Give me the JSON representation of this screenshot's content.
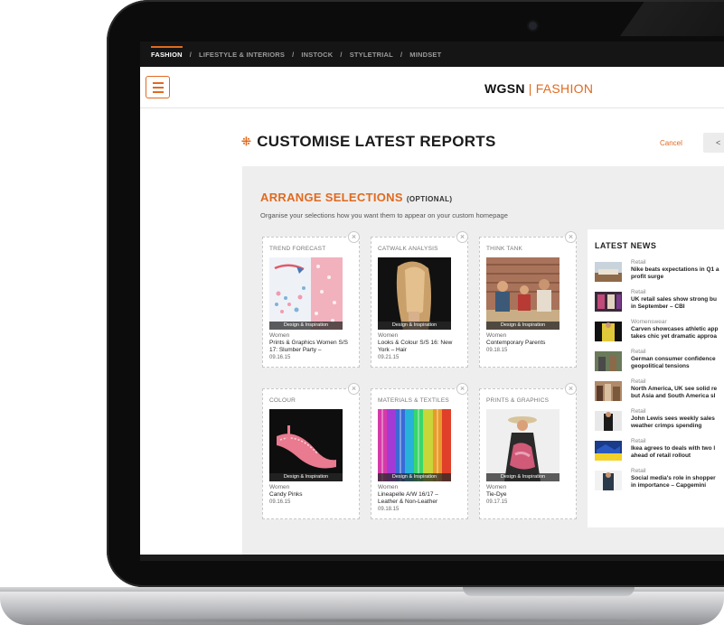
{
  "nav": {
    "items": [
      "FASHION",
      "LIFESTYLE & INTERIORS",
      "INSTOCK",
      "STYLETRIAL",
      "MINDSET"
    ],
    "separator": "/"
  },
  "brand": {
    "name": "WGSN",
    "divider": "|",
    "section": "FASHION"
  },
  "page": {
    "title": "CUSTOMISE LATEST REPORTS",
    "cancel_label": "Cancel",
    "back_label": "<"
  },
  "arrange": {
    "title": "ARRANGE SELECTIONS",
    "optional": "(OPTIONAL)",
    "description": "Organise your selections how you want them to appear on your custom homepage",
    "close_symbol": "×"
  },
  "cards": [
    {
      "category": "TREND FORECAST",
      "tag": "Design & Inspiration",
      "gender": "Women",
      "name": "Prints & Graphics Women S/S 17: Slumber Party –",
      "date": "09.16.15"
    },
    {
      "category": "CATWALK ANALYSIS",
      "tag": "Design & Inspiration",
      "gender": "Women",
      "name": "Looks & Colour S/S 16: New York – Hair",
      "date": "09.21.15"
    },
    {
      "category": "THINK TANK",
      "tag": "Design & Inspiration",
      "gender": "Women",
      "name": "Contemporary Parents",
      "date": "09.18.15"
    },
    {
      "category": "COLOUR",
      "tag": "Design & Inspiration",
      "gender": "Women",
      "name": "Candy Pinks",
      "date": "09.16.15"
    },
    {
      "category": "MATERIALS & TEXTILES",
      "tag": "Design & Inspiration",
      "gender": "Women",
      "name": "Lineapelle A/W 16/17 – Leather & Non-Leather",
      "date": "09.18.15"
    },
    {
      "category": "PRINTS & GRAPHICS",
      "tag": "Design & Inspiration",
      "gender": "Women",
      "name": "Tie-Dye",
      "date": "09.17.15"
    }
  ],
  "news": {
    "title": "LATEST NEWS",
    "items": [
      {
        "category": "Retail",
        "headline": "Nike beats expectations in Q1 a\nprofit surge"
      },
      {
        "category": "Retail",
        "headline": "UK retail sales show strong bu\nin September – CBI"
      },
      {
        "category": "Womenswear",
        "headline": "Carven showcases athletic app\ntakes chic yet dramatic approa"
      },
      {
        "category": "Retail",
        "headline": "German consumer confidence\ngeopolitical tensions"
      },
      {
        "category": "Retail",
        "headline": "North America, UK see solid re\nbut Asia and South America sl"
      },
      {
        "category": "Retail",
        "headline": "John Lewis sees weekly sales\nweather crimps spending"
      },
      {
        "category": "Retail",
        "headline": "Ikea agrees to deals with two l\nahead of retail rollout"
      },
      {
        "category": "Retail",
        "headline": "Social media's role in shopper\nin importance – Capgemini"
      }
    ]
  },
  "colors": {
    "accent": "#e06a1f",
    "nav_bg": "#151515",
    "panel_bg": "#eeeeee"
  },
  "icons": {
    "menu": "hamburger-icon",
    "title": "grid-dots-icon",
    "close": "close-icon"
  }
}
